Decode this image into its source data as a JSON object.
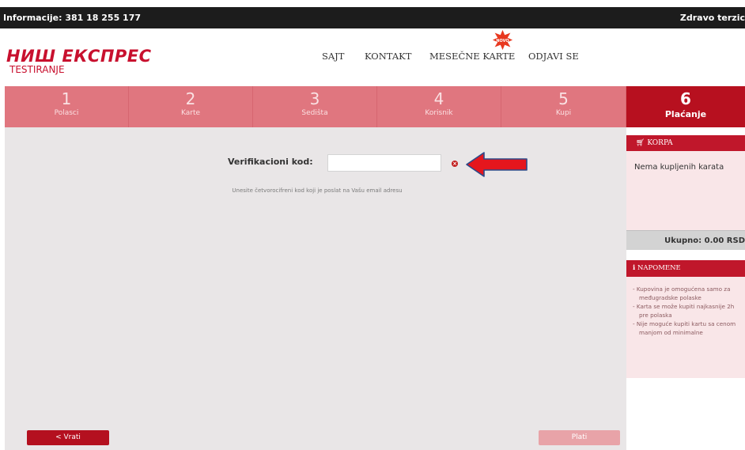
{
  "topbar": {
    "info": "Informacije: 381 18 255 177",
    "greeting": "Zdravo terzic"
  },
  "logo": {
    "main": "НИШ ЕКСПРЕС",
    "sub": "TESTIRANJE"
  },
  "nav": {
    "items": [
      "SAJT",
      "KONTAKT",
      "MESEČNE KARTE",
      "ODJAVI SE"
    ],
    "badge_text": "NOVO",
    "badge_color": "#e8381f"
  },
  "steps": [
    {
      "num": "1",
      "label": "Polasci"
    },
    {
      "num": "2",
      "label": "Karte"
    },
    {
      "num": "3",
      "label": "Sedišta"
    },
    {
      "num": "4",
      "label": "Korisnik"
    },
    {
      "num": "5",
      "label": "Kupi"
    },
    {
      "num": "6",
      "label": "Plaćanje"
    }
  ],
  "verification": {
    "label": "Verifikacioni kod:",
    "value": "",
    "hint": "Unesite četvorocifreni kod koji je poslat na Vašu email adresu",
    "error_icon": "x-circle-icon"
  },
  "buttons": {
    "back": "< Vrati",
    "pay": "Plati"
  },
  "cart": {
    "title": "KORPA",
    "icon": "cart-icon",
    "empty_text": "Nema kupljenih karata",
    "total": "Ukupno: 0.00 RSD"
  },
  "notes": {
    "title": "NAPOMENE",
    "icon": "info-icon",
    "items": [
      "- Kupovina je omogućena samo za međugradske polaske",
      "- Karta se može kupiti najkasnije 2h pre polaska",
      "- Nije moguće kupiti kartu sa cenom manjom od minimalne"
    ]
  },
  "colors": {
    "brand": "#c8102e",
    "step_inactive": "#e0767f",
    "step_active": "#b7101f",
    "arrow": "#e5161d"
  }
}
